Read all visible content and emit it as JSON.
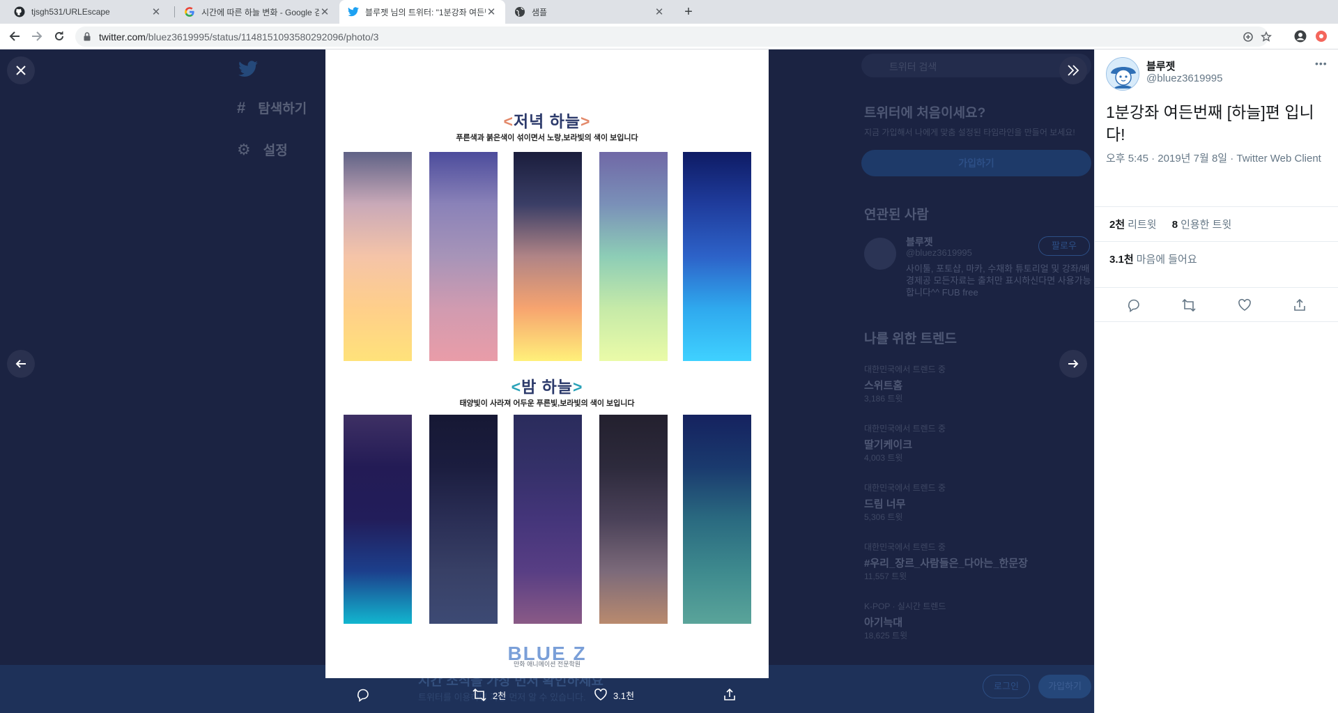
{
  "browser": {
    "tabs": [
      {
        "title": "tjsgh531/URLEscape",
        "icon": "github-icon"
      },
      {
        "title": "시간에 따른 하늘 변화 - Google 검색",
        "icon": "google-icon"
      },
      {
        "title": "블루젯 님의 트위터: \"1분강좌 여든번째 [하늘]편 입니다!\"",
        "icon": "twitter-icon"
      },
      {
        "title": "샘플",
        "icon": "globe-icon"
      }
    ],
    "url_host": "twitter.com",
    "url_path": "/bluez3619995/status/1148151093580292096/photo/3"
  },
  "background": {
    "nav": [
      "탐색하기",
      "설정"
    ],
    "search_placeholder": "트위터 검색",
    "new_title": "트위터에 처음이세요?",
    "new_desc": "지금 가입해서 나에게 맞춤 설정된 타임라인을 만들어 보세요!",
    "signup": "가입하기",
    "related_title": "연관된 사람",
    "related_name": "블루젯",
    "related_handle": "@bluez3619995",
    "related_follow": "팔로우",
    "related_bio": "사이툴, 포토샵, 마카, 수채화 튜토리얼 및 강좌/배경제공 모든자료는 출처만 표시하신다면 사용가능합니다^^ FUB free",
    "trends_title": "나를 위한 트렌드",
    "trends": [
      {
        "label": "대한민국에서 트렌드 중",
        "name": "스위트홈",
        "count": "3,186 트윗"
      },
      {
        "label": "대한민국에서 트렌드 중",
        "name": "딸기케이크",
        "count": "4,003 트윗"
      },
      {
        "label": "대한민국에서 트렌드 중",
        "name": "드림 너무",
        "count": "5,306 트윗"
      },
      {
        "label": "대한민국에서 트렌드 중",
        "name": "#우리_장르_사람들은_다아는_한문장",
        "count": "11,557 트윗"
      },
      {
        "label": "K-POP · 실시간 트렌드",
        "name": "아기늑대",
        "count": "18,625 트윗"
      }
    ],
    "bottom_title": "시간 소식을 가장 먼저 확인하세요",
    "bottom_sub": "트위터를 이용하면 가장 먼저 알 수 있습니다.",
    "login": "로그인",
    "join": "가입하기"
  },
  "photo": {
    "evening_title": "저녁 하늘",
    "evening_sub": "푸른색과 붉은색이 섞이면서 노랑,보라빛의 색이 보입니다",
    "night_title": "밤 하늘",
    "night_sub": "태양빛이 사라져 어두운 푸른빛,보라빛의 색이 보입니다",
    "brand": "BLUE Z",
    "brand_sub": "만화 애니메이션 전문학원",
    "evening_gradients": [
      [
        "#5f6286",
        "#c9a9b8",
        "#f5c4a8",
        "#ffcf8a",
        "#ffe27a"
      ],
      [
        "#4c4c9c",
        "#8a82b8",
        "#a794b8",
        "#d19bb0",
        "#e99ca8"
      ],
      [
        "#1a1d3c",
        "#3a3e66",
        "#b08486",
        "#f7a46f",
        "#fff07a"
      ],
      [
        "#7068a6",
        "#7a90b8",
        "#8dcdb6",
        "#c6eaa8",
        "#eafba8"
      ],
      [
        "#0e1b64",
        "#1f3c9c",
        "#2d62c8",
        "#2fa9ee",
        "#3fd1ff"
      ]
    ],
    "night_gradients": [
      [
        "#3e3064",
        "#231b55",
        "#221d5a",
        "#1c3f8c",
        "#12b6cf"
      ],
      [
        "#161834",
        "#1b1d3f",
        "#2a2e55",
        "#384066",
        "#3d4a74"
      ],
      [
        "#2a2c5c",
        "#343068",
        "#44357a",
        "#583e84",
        "#8a5a86"
      ],
      [
        "#23202e",
        "#2d2a3c",
        "#4a4158",
        "#7c6a7a",
        "#b98a6e"
      ],
      [
        "#15225f",
        "#1a3a6e",
        "#2a6a80",
        "#3e8a8e",
        "#5aa49a"
      ]
    ]
  },
  "photo_actions": {
    "retweets": "2천",
    "likes": "3.1천"
  },
  "tweet": {
    "name": "블루젯",
    "handle": "@bluez3619995",
    "text": "1분강좌 여든번째 [하늘]편 입니다!",
    "meta": "오후 5:45 · 2019년 7월 8일 · Twitter Web Client",
    "retweet_count": "2천",
    "retweet_label": "리트윗",
    "quote_count": "8",
    "quote_label": "인용한 트윗",
    "like_count": "3.1천",
    "like_label": "마음에 들어요"
  }
}
